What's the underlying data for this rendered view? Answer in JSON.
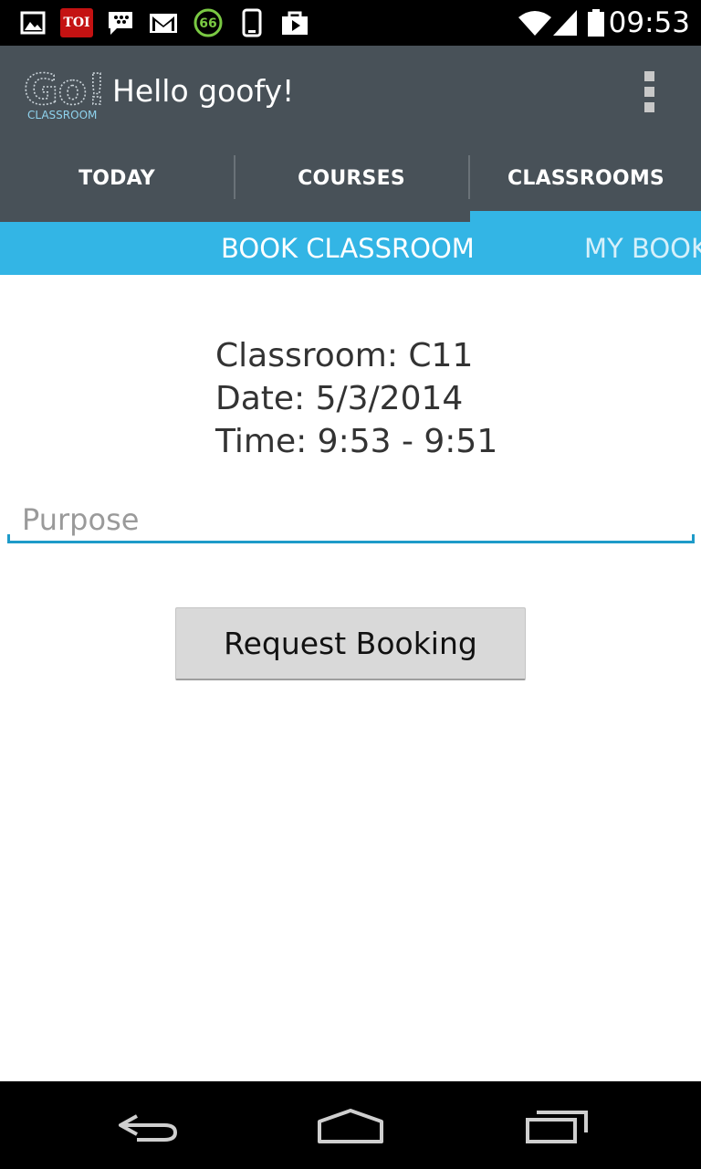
{
  "status_bar": {
    "time": "09:53",
    "notification_icons": [
      "gallery-icon",
      "toi-icon",
      "bbm-icon",
      "gmail-icon",
      "battery-percent-icon",
      "phone-icon",
      "play-store-icon"
    ],
    "toi_label": "TOI",
    "percent_label": "66",
    "right_icons": [
      "wifi-icon",
      "signal-icon",
      "battery-icon"
    ]
  },
  "action_bar": {
    "logo_text": "Go!",
    "logo_subtext": "CLASSROOM",
    "title": "Hello goofy!",
    "overflow_icon": "overflow-menu-icon"
  },
  "tabs": [
    {
      "label": "TODAY",
      "selected": false
    },
    {
      "label": "COURSES",
      "selected": false
    },
    {
      "label": "CLASSROOMS",
      "selected": true
    }
  ],
  "sub_tabs": {
    "active": "BOOK CLASSROOM",
    "next": "MY BOOK"
  },
  "booking": {
    "classroom_line": "Classroom: C11",
    "date_line": "Date: 5/3/2014",
    "time_line": "Time: 9:53 - 9:51"
  },
  "purpose_input": {
    "placeholder": "Purpose",
    "value": ""
  },
  "request_button_label": "Request Booking",
  "nav_bar": {
    "buttons": [
      "back-icon",
      "home-icon",
      "recent-apps-icon"
    ]
  },
  "colors": {
    "status_bar": "#000000",
    "action_bar": "#485158",
    "accent": "#33b5e5",
    "field_underline": "#1e9bc9",
    "button_bg": "#d9d9d9"
  }
}
